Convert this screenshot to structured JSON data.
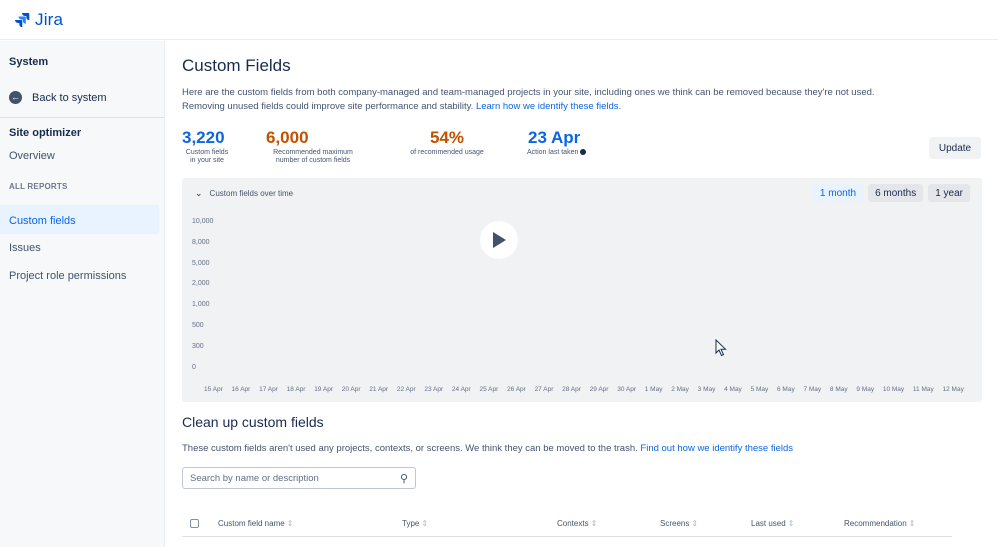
{
  "app": {
    "logo_text": "Jira"
  },
  "sidebar": {
    "title": "System",
    "back_label": "Back to system",
    "site_optimizer_label": "Site optimizer",
    "overview_label": "Overview",
    "section_label": "ALL REPORTS",
    "items": [
      {
        "label": "Custom fields"
      },
      {
        "label": "Issues"
      },
      {
        "label": "Project role permissions"
      }
    ]
  },
  "main": {
    "title": "Custom Fields",
    "description_1": "Here are the custom fields from both company-managed and team-managed projects in your site, including ones we think can be removed because they're not used.",
    "description_2": "Removing unused fields could improve site performance and stability.",
    "learn_link": "Learn how we identify these fields.",
    "stats": [
      {
        "value": "3,220",
        "label_1": "Custom fields",
        "label_2": "in your site",
        "color": "#0c66e4"
      },
      {
        "value": "6,000",
        "label_1": "Recommended maximum",
        "label_2": "number of custom fields",
        "color": "#c25100"
      },
      {
        "value": "54%",
        "label_1": "of recommended usage",
        "label_2": "",
        "color": "#c25100"
      },
      {
        "value": "23 Apr",
        "label_1": "Action last taken",
        "label_2": "",
        "color": "#0c66e4"
      }
    ],
    "update_button": "Update"
  },
  "chart_panel": {
    "heading": "Custom fields over time",
    "ranges": [
      {
        "label": "1 month",
        "active": true
      },
      {
        "label": "6 months",
        "active": false
      },
      {
        "label": "1 year",
        "active": false
      }
    ]
  },
  "chart_data": {
    "type": "line",
    "y_ticks": [
      "10,000",
      "8,000",
      "5,000",
      "2,000",
      "1,000",
      "500",
      "300",
      "0"
    ],
    "x": [
      "15 Apr",
      "16 Apr",
      "17 Apr",
      "18 Apr",
      "19 Apr",
      "20 Apr",
      "21 Apr",
      "22 Apr",
      "23 Apr",
      "24 Apr",
      "25 Apr",
      "26 Apr",
      "27 Apr",
      "28 Apr",
      "29 Apr",
      "30 Apr",
      "1 May",
      "2 May",
      "3 May",
      "4 May",
      "5 May",
      "6 May",
      "7 May",
      "8 May",
      "9 May",
      "10 May",
      "11 May",
      "12 May"
    ],
    "series": []
  },
  "cleanup": {
    "title": "Clean up custom fields",
    "description": "These custom fields aren't used any projects, contexts, or screens. We think they can be moved to the trash.",
    "link": "Find out how we identify these fields",
    "search_placeholder": "Search by name or description",
    "columns": [
      "Custom field name",
      "Type",
      "Contexts",
      "Screens",
      "Last used",
      "Recommendation"
    ]
  }
}
